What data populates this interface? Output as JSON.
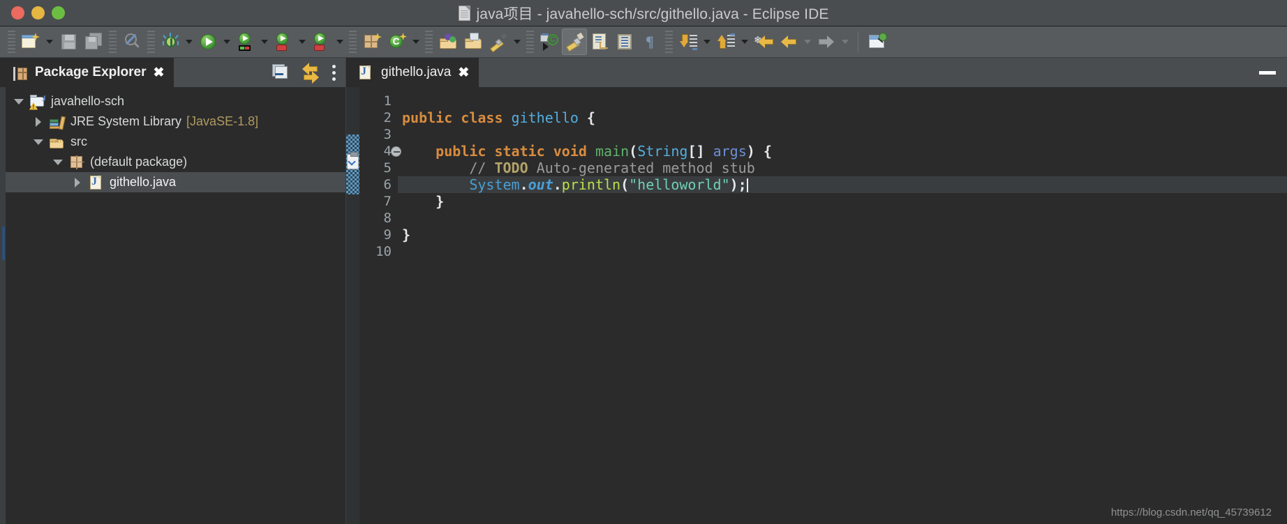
{
  "window": {
    "title": "java项目 - javahello-sch/src/githello.java - Eclipse IDE",
    "doc_icon": "document-icon",
    "controls": {
      "close": "close",
      "minimize": "minimize",
      "maximize": "maximize"
    }
  },
  "toolbar": {
    "items": [
      {
        "name": "new-wizard",
        "icon": "new-file-icon",
        "label": "New",
        "has_dropdown": true
      },
      {
        "name": "save",
        "icon": "save-icon",
        "label": "Save",
        "has_dropdown": false
      },
      {
        "name": "save-all",
        "icon": "save-all-icon",
        "label": "Save All",
        "has_dropdown": false
      },
      {
        "name": "no-search",
        "icon": "search-disabled-icon",
        "label": "Search",
        "has_dropdown": false
      },
      {
        "name": "debug",
        "icon": "debug-bug-icon",
        "label": "Debug",
        "has_dropdown": true
      },
      {
        "name": "run",
        "icon": "run-play-icon",
        "label": "Run",
        "has_dropdown": true
      },
      {
        "name": "run-configurations",
        "icon": "run-config-icon",
        "label": "Run Configurations",
        "has_dropdown": true
      },
      {
        "name": "coverage",
        "icon": "run-coverage-icon",
        "label": "Coverage",
        "has_dropdown": true
      },
      {
        "name": "external-tools",
        "icon": "external-tools-icon",
        "label": "External Tools",
        "has_dropdown": false
      },
      {
        "name": "new-java-package",
        "icon": "new-package-icon",
        "label": "New Java Package",
        "has_dropdown": false
      },
      {
        "name": "new-java-class",
        "icon": "new-class-icon",
        "label": "New Java Class",
        "has_dropdown": true
      },
      {
        "name": "open-type",
        "icon": "open-type-icon",
        "label": "Open Type",
        "has_dropdown": false
      },
      {
        "name": "open-task",
        "icon": "open-task-icon",
        "label": "Open Task",
        "has_dropdown": false
      },
      {
        "name": "quick-fix",
        "icon": "pen-icon",
        "label": "Quick Fix",
        "has_dropdown": true
      },
      {
        "name": "cvs-checkout",
        "icon": "cvs-icon",
        "label": "CVS Checkout",
        "has_dropdown": false
      },
      {
        "name": "toggle-mark-occurrences",
        "icon": "brush-icon",
        "label": "Toggle Mark Occurrences",
        "has_dropdown": false,
        "active": true
      },
      {
        "name": "show-whitespace",
        "icon": "page-return-icon",
        "label": "Show Whitespace Characters",
        "has_dropdown": false
      },
      {
        "name": "toggle-block-selection",
        "icon": "block-selection-icon",
        "label": "Toggle Block Selection",
        "has_dropdown": false
      },
      {
        "name": "pilcrow",
        "icon": "pilcrow-icon",
        "label": "Paragraph",
        "has_dropdown": false
      },
      {
        "name": "next-annotation",
        "icon": "next-annotation-icon",
        "label": "Next Annotation",
        "has_dropdown": true
      },
      {
        "name": "previous-annotation",
        "icon": "previous-annotation-icon",
        "label": "Previous Annotation",
        "has_dropdown": false
      },
      {
        "name": "last-edit-location",
        "icon": "last-edit-location-icon",
        "label": "Last Edit Location",
        "has_dropdown": false
      },
      {
        "name": "back",
        "icon": "back-arrow-icon",
        "label": "Back",
        "has_dropdown": true
      },
      {
        "name": "forward",
        "icon": "forward-arrow-icon",
        "label": "Forward",
        "has_dropdown": true,
        "disabled": true
      },
      {
        "name": "open-perspective",
        "icon": "open-perspective-icon",
        "label": "Open Perspective",
        "has_dropdown": false
      }
    ]
  },
  "explorer": {
    "tab_label": "Package Explorer",
    "tab_icon": "package-explorer-icon",
    "close_glyph": "✖",
    "tools": [
      {
        "name": "collapse-all",
        "icon": "collapse-all-icon",
        "label": "Collapse All"
      },
      {
        "name": "link-with-editor",
        "icon": "link-with-editor-icon",
        "label": "Link with Editor"
      },
      {
        "name": "view-menu",
        "icon": "kebab-menu-icon",
        "label": "View Menu"
      }
    ],
    "tree": [
      {
        "label": "javahello-sch",
        "icon": "java-project-icon",
        "twisty": "down",
        "indent": 0,
        "selected": false,
        "suffix": ""
      },
      {
        "label": "JRE System Library",
        "icon": "jre-library-icon",
        "twisty": "right",
        "indent": 1,
        "selected": false,
        "suffix": "[JavaSE-1.8]"
      },
      {
        "label": "src",
        "icon": "source-folder-icon",
        "twisty": "down",
        "indent": 1,
        "selected": false,
        "suffix": ""
      },
      {
        "label": "(default package)",
        "icon": "package-icon",
        "twisty": "down",
        "indent": 2,
        "selected": false,
        "suffix": ""
      },
      {
        "label": "githello.java",
        "icon": "java-file-icon",
        "twisty": "right",
        "indent": 3,
        "selected": true,
        "suffix": ""
      }
    ]
  },
  "editor": {
    "tab_label": "githello.java",
    "tab_icon": "java-file-icon",
    "close_glyph": "✖",
    "minimize_label": "Minimize",
    "line_numbers": [
      "1",
      "2",
      "3",
      "4",
      "5",
      "6",
      "7",
      "8",
      "9",
      "10"
    ],
    "fold_marker_line": "4",
    "current_line": "6",
    "lines": [
      {
        "n": "1",
        "tokens": []
      },
      {
        "n": "2",
        "tokens": [
          {
            "t": "public ",
            "c": "kw"
          },
          {
            "t": "class ",
            "c": "kw"
          },
          {
            "t": "githello",
            "c": "cls"
          },
          {
            "t": " ",
            "c": "pnc"
          },
          {
            "t": "{",
            "c": "pnc"
          }
        ]
      },
      {
        "n": "3",
        "tokens": []
      },
      {
        "n": "4",
        "tokens": [
          {
            "t": "    ",
            "c": "pnc"
          },
          {
            "t": "public ",
            "c": "kw"
          },
          {
            "t": "static ",
            "c": "kw"
          },
          {
            "t": "void ",
            "c": "kw"
          },
          {
            "t": "main",
            "c": "typ"
          },
          {
            "t": "(",
            "c": "pnc"
          },
          {
            "t": "String",
            "c": "cls"
          },
          {
            "t": "[]",
            "c": "pnc"
          },
          {
            "t": " ",
            "c": "pnc"
          },
          {
            "t": "args",
            "c": "ident"
          },
          {
            "t": ")",
            "c": "pnc"
          },
          {
            "t": " {",
            "c": "pnc"
          }
        ]
      },
      {
        "n": "5",
        "tokens": [
          {
            "t": "        ",
            "c": "pnc"
          },
          {
            "t": "// ",
            "c": "cmt"
          },
          {
            "t": "TODO",
            "c": "todo"
          },
          {
            "t": " Auto-generated method stub",
            "c": "cmt"
          }
        ]
      },
      {
        "n": "6",
        "tokens": [
          {
            "t": "        ",
            "c": "pnc"
          },
          {
            "t": "System",
            "c": "sysc"
          },
          {
            "t": ".",
            "c": "pnc"
          },
          {
            "t": "out",
            "c": "outf"
          },
          {
            "t": ".",
            "c": "pnc"
          },
          {
            "t": "println",
            "c": "meth"
          },
          {
            "t": "(",
            "c": "pnc"
          },
          {
            "t": "\"helloworld\"",
            "c": "str"
          },
          {
            "t": ");",
            "c": "pnc"
          }
        ],
        "caret": true
      },
      {
        "n": "7",
        "tokens": [
          {
            "t": "    }",
            "c": "pnc"
          }
        ]
      },
      {
        "n": "8",
        "tokens": []
      },
      {
        "n": "9",
        "tokens": [
          {
            "t": "}",
            "c": "pnc"
          }
        ]
      },
      {
        "n": "10",
        "tokens": []
      }
    ]
  },
  "watermark": "https://blog.csdn.net/qq_45739612",
  "colors": {
    "titlebar_bg": "#4a4d4f",
    "toolbar_bg": "#585b5d",
    "editor_bg": "#2b2b2b",
    "tab_active_bg": "#2b2b2b",
    "selection_bg": "#4a4d4f",
    "keyword": "#d98c3f",
    "class_name": "#54aee0",
    "method": "#b8e04a",
    "string": "#6fd1b0",
    "comment": "#9a9a9a",
    "todo": "#b4a36a",
    "library_suffix": "#b09a5f"
  }
}
